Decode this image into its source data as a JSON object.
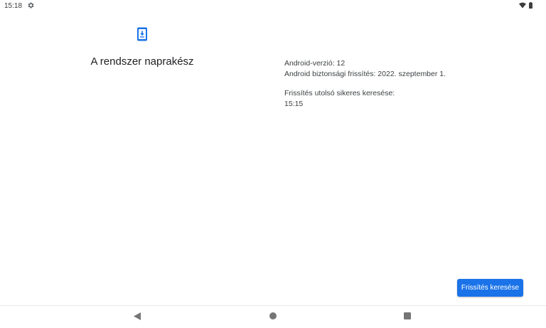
{
  "status_bar": {
    "time": "15:18",
    "icons": [
      "settings-gear-icon",
      "wifi-icon",
      "battery-icon"
    ]
  },
  "update": {
    "icon": "system-update-icon",
    "title": "A rendszer naprakész",
    "accent_color": "#1a73e8"
  },
  "info": {
    "android_version": "Android-verzió: 12",
    "security_update": "Android biztonsági frissítés: 2022. szeptember 1.",
    "last_check_label": "Frissítés utolsó sikeres keresése:",
    "last_check_time": "15:15"
  },
  "actions": {
    "check_button_label": "Frissítés keresése"
  },
  "navigation": {
    "icons": [
      "back-icon",
      "home-icon",
      "recents-icon"
    ]
  }
}
